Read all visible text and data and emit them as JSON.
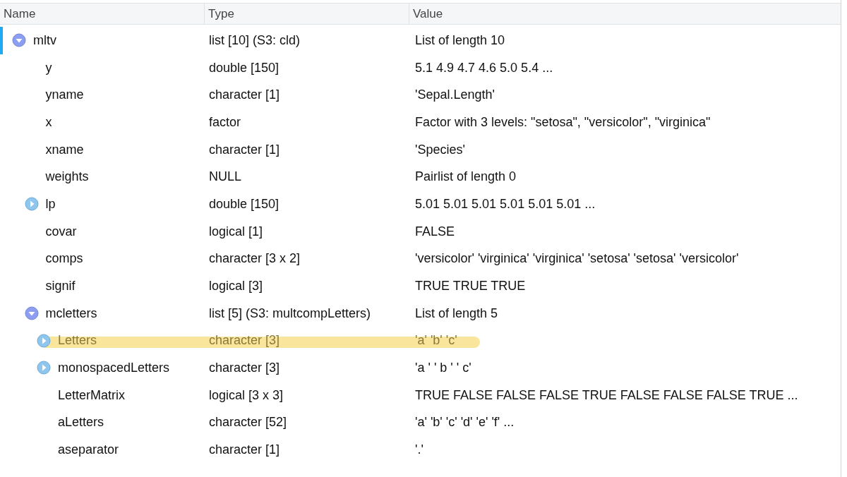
{
  "columns": [
    "Name",
    "Type",
    "Value"
  ],
  "rows": [
    {
      "name": "mltv",
      "type": "list [10] (S3: cld)",
      "value": "List of length 10",
      "kind": "expandable",
      "expanded": true,
      "selected": true,
      "highlighted": false,
      "children": [
        {
          "name": "y",
          "type": "double [150]",
          "value": "5.1 4.9 4.7 4.6 5.0 5.4 ...",
          "kind": "leaf",
          "selected": false,
          "highlighted": false
        },
        {
          "name": "yname",
          "type": "character [1]",
          "value": "'Sepal.Length'",
          "kind": "leaf",
          "selected": false,
          "highlighted": false
        },
        {
          "name": "x",
          "type": "factor",
          "value": "Factor with 3 levels: \"setosa\", \"versicolor\", \"virginica\"",
          "kind": "leaf",
          "selected": false,
          "highlighted": false
        },
        {
          "name": "xname",
          "type": "character [1]",
          "value": "'Species'",
          "kind": "leaf",
          "selected": false,
          "highlighted": false
        },
        {
          "name": "weights",
          "type": "NULL",
          "value": "Pairlist of length 0",
          "kind": "leaf",
          "selected": false,
          "highlighted": false
        },
        {
          "name": "lp",
          "type": "double [150]",
          "value": "5.01 5.01 5.01 5.01 5.01 5.01 ...",
          "kind": "expandable",
          "expanded": false,
          "selected": false,
          "highlighted": false
        },
        {
          "name": "covar",
          "type": "logical [1]",
          "value": "FALSE",
          "kind": "leaf",
          "selected": false,
          "highlighted": false
        },
        {
          "name": "comps",
          "type": "character [3 x 2]",
          "value": "'versicolor' 'virginica' 'virginica' 'setosa' 'setosa' 'versicolor'",
          "kind": "leaf",
          "selected": false,
          "highlighted": false
        },
        {
          "name": "signif",
          "type": "logical [3]",
          "value": "TRUE TRUE TRUE",
          "kind": "leaf",
          "selected": false,
          "highlighted": false
        },
        {
          "name": "mcletters",
          "type": "list [5] (S3: multcompLetters)",
          "value": "List of length 5",
          "kind": "expandable",
          "expanded": true,
          "selected": false,
          "highlighted": false,
          "children": [
            {
              "name": "Letters",
              "type": "character [3]",
              "value": "'a' 'b' 'c'",
              "kind": "expandable",
              "expanded": false,
              "selected": false,
              "highlighted": true
            },
            {
              "name": "monospacedLetters",
              "type": "character [3]",
              "value": "'a ' ' b ' ' c'",
              "kind": "expandable",
              "expanded": false,
              "selected": false,
              "highlighted": false
            },
            {
              "name": "LetterMatrix",
              "type": "logical [3 x 3]",
              "value": "TRUE FALSE FALSE FALSE TRUE FALSE FALSE FALSE TRUE ...",
              "kind": "leaf",
              "selected": false,
              "highlighted": false
            },
            {
              "name": "aLetters",
              "type": "character [52]",
              "value": "'a' 'b' 'c' 'd' 'e' 'f' ...",
              "kind": "leaf",
              "selected": false,
              "highlighted": false
            },
            {
              "name": "aseparator",
              "type": "character [1]",
              "value": "'.'",
              "kind": "leaf",
              "selected": false,
              "highlighted": false
            }
          ]
        }
      ]
    }
  ]
}
